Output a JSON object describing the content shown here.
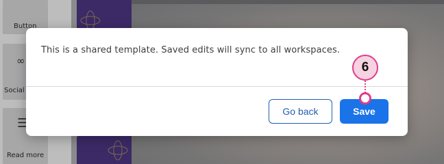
{
  "background": {
    "sidebar": {
      "items": [
        {
          "label": "Button",
          "icon": "button-icon"
        },
        {
          "label": "Social",
          "icon": "link-icon"
        },
        {
          "label": "Read more",
          "icon": "document-icon"
        }
      ]
    }
  },
  "dialog": {
    "message": "This is a shared template. Saved edits will sync to all workspaces.",
    "go_back_label": "Go back",
    "save_label": "Save"
  },
  "callout": {
    "step": "6",
    "color": "#e03c8a"
  },
  "colors": {
    "primary": "#1a73e8",
    "outline": "#1f5fb4"
  }
}
